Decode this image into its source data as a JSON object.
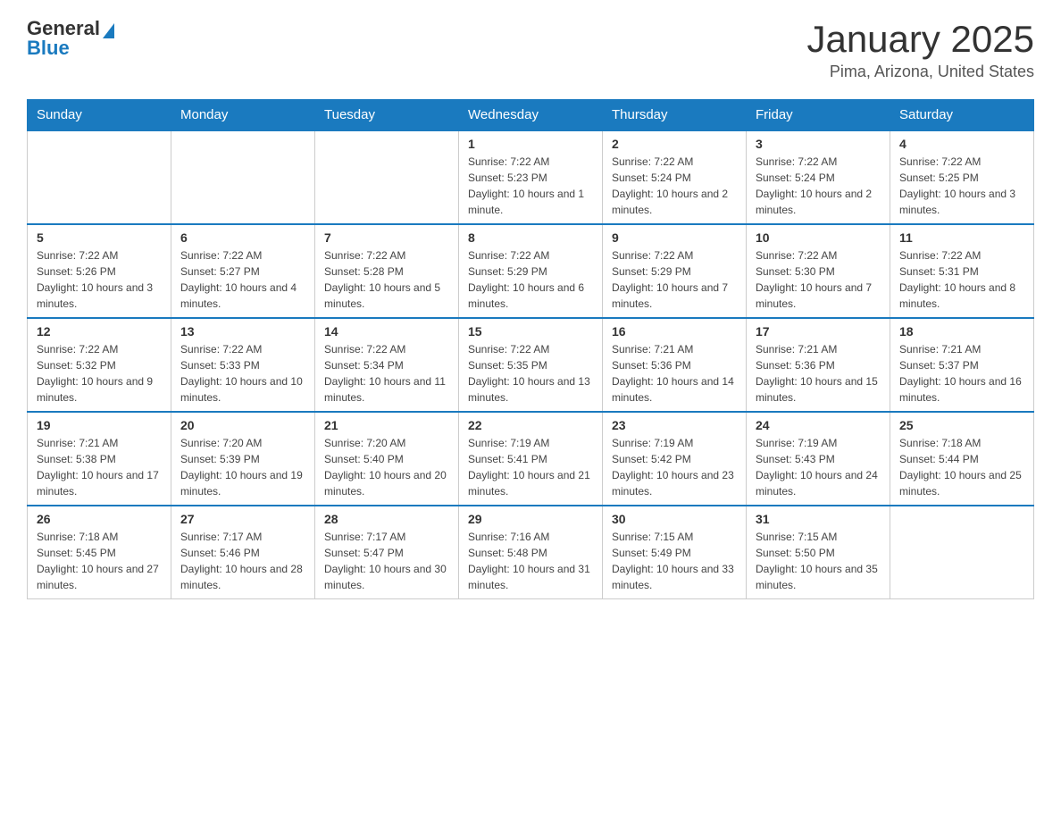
{
  "header": {
    "logo_line1": "General",
    "logo_line2": "Blue",
    "month_title": "January 2025",
    "location": "Pima, Arizona, United States"
  },
  "weekdays": [
    "Sunday",
    "Monday",
    "Tuesday",
    "Wednesday",
    "Thursday",
    "Friday",
    "Saturday"
  ],
  "weeks": [
    [
      {
        "day": "",
        "info": ""
      },
      {
        "day": "",
        "info": ""
      },
      {
        "day": "",
        "info": ""
      },
      {
        "day": "1",
        "info": "Sunrise: 7:22 AM\nSunset: 5:23 PM\nDaylight: 10 hours and 1 minute."
      },
      {
        "day": "2",
        "info": "Sunrise: 7:22 AM\nSunset: 5:24 PM\nDaylight: 10 hours and 2 minutes."
      },
      {
        "day": "3",
        "info": "Sunrise: 7:22 AM\nSunset: 5:24 PM\nDaylight: 10 hours and 2 minutes."
      },
      {
        "day": "4",
        "info": "Sunrise: 7:22 AM\nSunset: 5:25 PM\nDaylight: 10 hours and 3 minutes."
      }
    ],
    [
      {
        "day": "5",
        "info": "Sunrise: 7:22 AM\nSunset: 5:26 PM\nDaylight: 10 hours and 3 minutes."
      },
      {
        "day": "6",
        "info": "Sunrise: 7:22 AM\nSunset: 5:27 PM\nDaylight: 10 hours and 4 minutes."
      },
      {
        "day": "7",
        "info": "Sunrise: 7:22 AM\nSunset: 5:28 PM\nDaylight: 10 hours and 5 minutes."
      },
      {
        "day": "8",
        "info": "Sunrise: 7:22 AM\nSunset: 5:29 PM\nDaylight: 10 hours and 6 minutes."
      },
      {
        "day": "9",
        "info": "Sunrise: 7:22 AM\nSunset: 5:29 PM\nDaylight: 10 hours and 7 minutes."
      },
      {
        "day": "10",
        "info": "Sunrise: 7:22 AM\nSunset: 5:30 PM\nDaylight: 10 hours and 7 minutes."
      },
      {
        "day": "11",
        "info": "Sunrise: 7:22 AM\nSunset: 5:31 PM\nDaylight: 10 hours and 8 minutes."
      }
    ],
    [
      {
        "day": "12",
        "info": "Sunrise: 7:22 AM\nSunset: 5:32 PM\nDaylight: 10 hours and 9 minutes."
      },
      {
        "day": "13",
        "info": "Sunrise: 7:22 AM\nSunset: 5:33 PM\nDaylight: 10 hours and 10 minutes."
      },
      {
        "day": "14",
        "info": "Sunrise: 7:22 AM\nSunset: 5:34 PM\nDaylight: 10 hours and 11 minutes."
      },
      {
        "day": "15",
        "info": "Sunrise: 7:22 AM\nSunset: 5:35 PM\nDaylight: 10 hours and 13 minutes."
      },
      {
        "day": "16",
        "info": "Sunrise: 7:21 AM\nSunset: 5:36 PM\nDaylight: 10 hours and 14 minutes."
      },
      {
        "day": "17",
        "info": "Sunrise: 7:21 AM\nSunset: 5:36 PM\nDaylight: 10 hours and 15 minutes."
      },
      {
        "day": "18",
        "info": "Sunrise: 7:21 AM\nSunset: 5:37 PM\nDaylight: 10 hours and 16 minutes."
      }
    ],
    [
      {
        "day": "19",
        "info": "Sunrise: 7:21 AM\nSunset: 5:38 PM\nDaylight: 10 hours and 17 minutes."
      },
      {
        "day": "20",
        "info": "Sunrise: 7:20 AM\nSunset: 5:39 PM\nDaylight: 10 hours and 19 minutes."
      },
      {
        "day": "21",
        "info": "Sunrise: 7:20 AM\nSunset: 5:40 PM\nDaylight: 10 hours and 20 minutes."
      },
      {
        "day": "22",
        "info": "Sunrise: 7:19 AM\nSunset: 5:41 PM\nDaylight: 10 hours and 21 minutes."
      },
      {
        "day": "23",
        "info": "Sunrise: 7:19 AM\nSunset: 5:42 PM\nDaylight: 10 hours and 23 minutes."
      },
      {
        "day": "24",
        "info": "Sunrise: 7:19 AM\nSunset: 5:43 PM\nDaylight: 10 hours and 24 minutes."
      },
      {
        "day": "25",
        "info": "Sunrise: 7:18 AM\nSunset: 5:44 PM\nDaylight: 10 hours and 25 minutes."
      }
    ],
    [
      {
        "day": "26",
        "info": "Sunrise: 7:18 AM\nSunset: 5:45 PM\nDaylight: 10 hours and 27 minutes."
      },
      {
        "day": "27",
        "info": "Sunrise: 7:17 AM\nSunset: 5:46 PM\nDaylight: 10 hours and 28 minutes."
      },
      {
        "day": "28",
        "info": "Sunrise: 7:17 AM\nSunset: 5:47 PM\nDaylight: 10 hours and 30 minutes."
      },
      {
        "day": "29",
        "info": "Sunrise: 7:16 AM\nSunset: 5:48 PM\nDaylight: 10 hours and 31 minutes."
      },
      {
        "day": "30",
        "info": "Sunrise: 7:15 AM\nSunset: 5:49 PM\nDaylight: 10 hours and 33 minutes."
      },
      {
        "day": "31",
        "info": "Sunrise: 7:15 AM\nSunset: 5:50 PM\nDaylight: 10 hours and 35 minutes."
      },
      {
        "day": "",
        "info": ""
      }
    ]
  ]
}
